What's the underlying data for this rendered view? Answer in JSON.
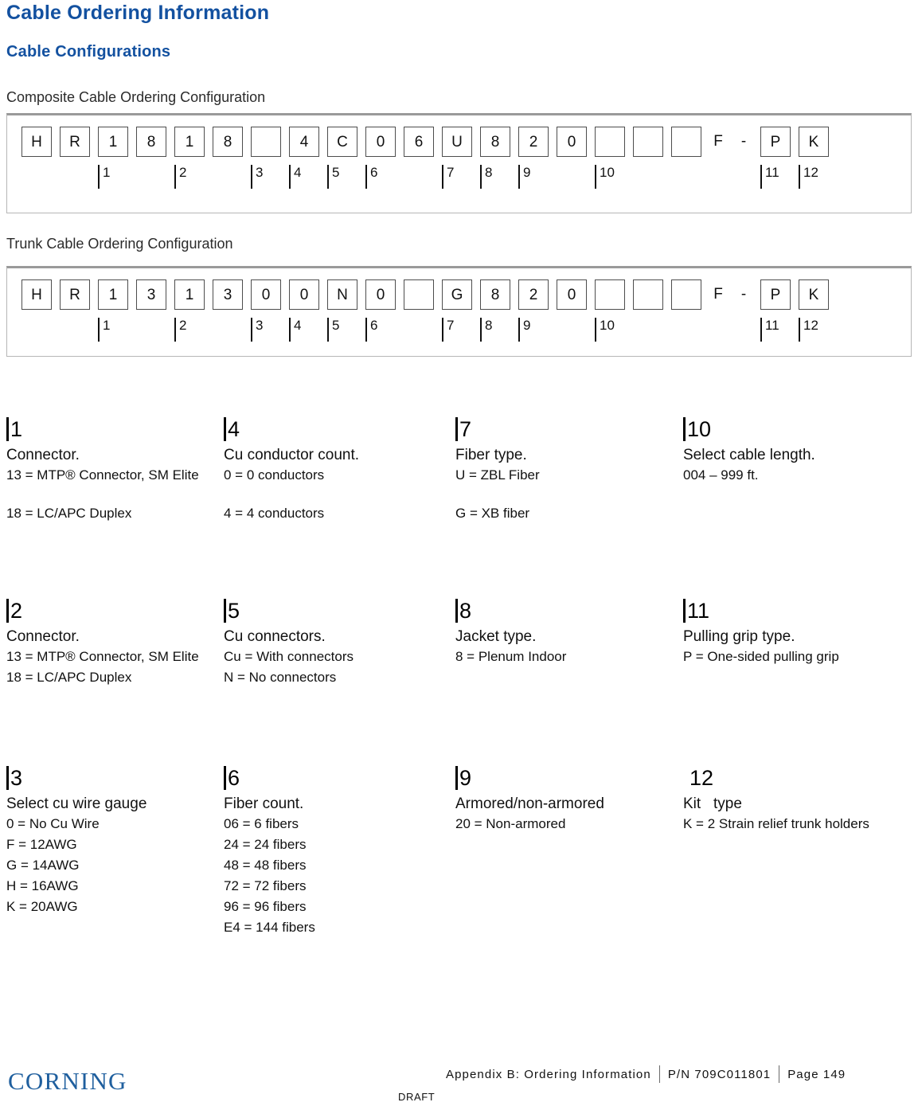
{
  "page": {
    "title": "Cable Ordering Information",
    "subtitle": "Cable Configurations"
  },
  "diagrams": [
    {
      "caption": "Composite Cable Ordering Configuration",
      "cells": [
        {
          "type": "box",
          "value": "H"
        },
        {
          "type": "box",
          "value": "R"
        },
        {
          "type": "box",
          "value": "1"
        },
        {
          "type": "box",
          "value": "8"
        },
        {
          "type": "box",
          "value": "1"
        },
        {
          "type": "box",
          "value": "8"
        },
        {
          "type": "box",
          "value": ""
        },
        {
          "type": "box",
          "value": "4"
        },
        {
          "type": "box",
          "value": "C"
        },
        {
          "type": "box",
          "value": "0"
        },
        {
          "type": "box",
          "value": "6"
        },
        {
          "type": "box",
          "value": "U"
        },
        {
          "type": "box",
          "value": "8"
        },
        {
          "type": "box",
          "value": "2"
        },
        {
          "type": "box",
          "value": "0"
        },
        {
          "type": "box",
          "value": ""
        },
        {
          "type": "box",
          "value": ""
        },
        {
          "type": "box",
          "value": ""
        },
        {
          "type": "text",
          "value": "F"
        },
        {
          "type": "text",
          "value": "-"
        },
        {
          "type": "box",
          "value": "P"
        },
        {
          "type": "box",
          "value": "K"
        }
      ],
      "markers": [
        {
          "label": "1",
          "cell": 2
        },
        {
          "label": "2",
          "cell": 4
        },
        {
          "label": "3",
          "cell": 6
        },
        {
          "label": "4",
          "cell": 7
        },
        {
          "label": "5",
          "cell": 8
        },
        {
          "label": "6",
          "cell": 9
        },
        {
          "label": "7",
          "cell": 11
        },
        {
          "label": "8",
          "cell": 12
        },
        {
          "label": "9",
          "cell": 13
        },
        {
          "label": "10",
          "cell": 15
        },
        {
          "label": "11",
          "cell": 20
        },
        {
          "label": "12",
          "cell": 21
        }
      ]
    },
    {
      "caption": "Trunk Cable Ordering Configuration",
      "cells": [
        {
          "type": "box",
          "value": "H"
        },
        {
          "type": "box",
          "value": "R"
        },
        {
          "type": "box",
          "value": "1"
        },
        {
          "type": "box",
          "value": "3"
        },
        {
          "type": "box",
          "value": "1"
        },
        {
          "type": "box",
          "value": "3"
        },
        {
          "type": "box",
          "value": "0"
        },
        {
          "type": "box",
          "value": "0"
        },
        {
          "type": "box",
          "value": "N"
        },
        {
          "type": "box",
          "value": "0"
        },
        {
          "type": "box",
          "value": ""
        },
        {
          "type": "box",
          "value": "G"
        },
        {
          "type": "box",
          "value": "8"
        },
        {
          "type": "box",
          "value": "2"
        },
        {
          "type": "box",
          "value": "0"
        },
        {
          "type": "box",
          "value": ""
        },
        {
          "type": "box",
          "value": ""
        },
        {
          "type": "box",
          "value": ""
        },
        {
          "type": "text",
          "value": "F"
        },
        {
          "type": "text",
          "value": "-"
        },
        {
          "type": "box",
          "value": "P"
        },
        {
          "type": "box",
          "value": "K"
        }
      ],
      "markers": [
        {
          "label": "1",
          "cell": 2
        },
        {
          "label": "2",
          "cell": 4
        },
        {
          "label": "3",
          "cell": 6
        },
        {
          "label": "4",
          "cell": 7
        },
        {
          "label": "5",
          "cell": 8
        },
        {
          "label": "6",
          "cell": 9
        },
        {
          "label": "7",
          "cell": 11
        },
        {
          "label": "8",
          "cell": 12
        },
        {
          "label": "9",
          "cell": 13
        },
        {
          "label": "10",
          "cell": 15
        },
        {
          "label": "11",
          "cell": 20
        },
        {
          "label": "12",
          "cell": 21
        }
      ]
    }
  ],
  "legend": [
    {
      "number": "1",
      "bar": true,
      "col": 0,
      "row": 0,
      "title": "Connector.",
      "lines": [
        "13 = MTP® Connector, SM Elite",
        "",
        "18 = LC/APC Duplex"
      ]
    },
    {
      "number": "4",
      "bar": true,
      "col": 1,
      "row": 0,
      "title": "Cu conductor count.",
      "lines": [
        "0 = 0 conductors",
        "",
        "4 = 4 conductors"
      ]
    },
    {
      "number": "7",
      "bar": true,
      "col": 2,
      "row": 0,
      "title": "Fiber type.",
      "lines": [
        "U = ZBL Fiber",
        "",
        "G = XB fiber"
      ]
    },
    {
      "number": "10",
      "bar": true,
      "col": 3,
      "row": 0,
      "title": "Select cable length.",
      "lines": [
        "004 – 999 ft."
      ]
    },
    {
      "number": "2",
      "bar": true,
      "col": 0,
      "row": 1,
      "title": "Connector.",
      "lines": [
        "13 = MTP® Connector, SM Elite",
        "18 = LC/APC Duplex"
      ]
    },
    {
      "number": "5",
      "bar": true,
      "col": 1,
      "row": 1,
      "title": "Cu connectors.",
      "lines": [
        "Cu = With connectors",
        "N = No connectors"
      ]
    },
    {
      "number": "8",
      "bar": true,
      "col": 2,
      "row": 1,
      "title": "Jacket type.",
      "lines": [
        "8 = Plenum Indoor"
      ]
    },
    {
      "number": "11",
      "bar": true,
      "col": 3,
      "row": 1,
      "title": "Pulling grip type.",
      "lines": [
        "P = One-sided pulling grip"
      ]
    },
    {
      "number": "3",
      "bar": true,
      "col": 0,
      "row": 2,
      "title": "Select cu wire gauge",
      "lines": [
        "0 = No Cu Wire",
        "F = 12AWG",
        "G = 14AWG",
        "H = 16AWG",
        "K = 20AWG"
      ]
    },
    {
      "number": "6",
      "bar": true,
      "col": 1,
      "row": 2,
      "title": "Fiber count.",
      "lines": [
        "06 = 6 fibers",
        "24 = 24 fibers",
        "48 = 48 fibers",
        "72 = 72 fibers",
        "96 = 96 fibers",
        "E4 = 144 fibers"
      ]
    },
    {
      "number": "9",
      "bar": true,
      "col": 2,
      "row": 2,
      "title": "Armored/non-armored",
      "lines": [
        "20 = Non-armored"
      ]
    },
    {
      "number": "12",
      "bar": false,
      "col": 3,
      "row": 2,
      "title": "Kit   type",
      "lines": [
        "K = 2 Strain relief trunk holders"
      ]
    }
  ],
  "footer": {
    "logo": "CORNING",
    "appendix": "Appendix B: Ordering Information",
    "part_number": "P/N 709C011801",
    "page": "Page 149",
    "draft": "DRAFT"
  }
}
